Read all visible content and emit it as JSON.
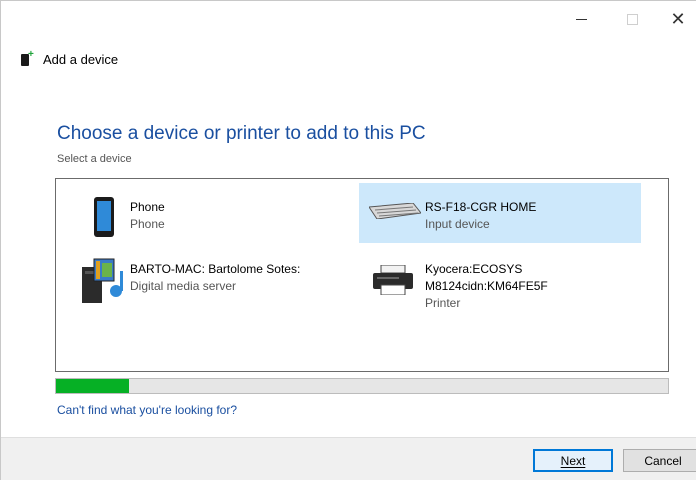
{
  "window": {
    "title": "Add a device",
    "controls": {
      "minimize_icon": "minimize-icon",
      "maximize_icon": "maximize-icon",
      "close_icon": "close-icon",
      "close_glyph": "✕"
    }
  },
  "main": {
    "heading": "Choose a device or printer to add to this PC",
    "subheading": "Select a device",
    "devices": [
      {
        "name": "Phone",
        "type": "Phone",
        "icon": "phone-icon",
        "selected": false
      },
      {
        "name": "RS-F18-CGR HOME",
        "type": "Input device",
        "icon": "keyboard-icon",
        "selected": true
      },
      {
        "name": "BARTO-MAC: Bartolome Sotes:",
        "type": "Digital media server",
        "icon": "media-server-icon",
        "selected": false
      },
      {
        "name_line1": "Kyocera:ECOSYS",
        "name_line2": "M8124cidn:KM64FE5F",
        "type": "Printer",
        "icon": "printer-icon",
        "selected": false
      }
    ],
    "progress": 0.12,
    "help_link": "Can't find what you're looking for?"
  },
  "footer": {
    "next_label": "Next",
    "cancel_label": "Cancel"
  },
  "colors": {
    "accent": "#1a4fa0",
    "selection": "#cde8fb",
    "progress_fill": "#06b025"
  }
}
